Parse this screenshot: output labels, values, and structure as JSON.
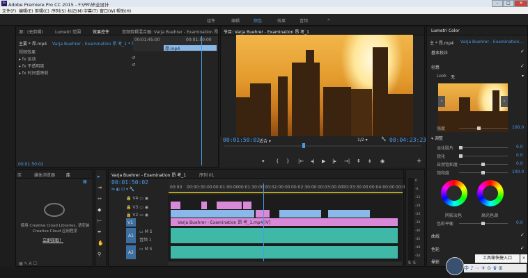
{
  "window": {
    "title": "Adobe Premiere Pro CC 2015 - F:\\PR\\毕业设计",
    "logo": "Pr"
  },
  "menu": [
    "文件(F)",
    "编辑(E)",
    "剪辑(C)",
    "序列(S)",
    "标记(M)",
    "字幕(T)",
    "窗口(W)",
    "帮助(H)"
  ],
  "workspaces": [
    "组件",
    "编辑",
    "颜色",
    "效果",
    "音频"
  ],
  "workspace_active": "颜色",
  "workspace_more": "»",
  "effect_controls": {
    "tabs": [
      "源：(无剪辑)",
      "Lumetri 范围",
      "效果控件",
      "音频剪辑混合器: Varja Buehrer - Examination 昂"
    ],
    "source": "主要 * 昂.mp4",
    "sequence": "Varja Buehrer - Examination 昂 考_1 * 昂...",
    "section": "视频效果",
    "ruler": [
      "00:01:45:00",
      "00:01:50:00"
    ],
    "clip": "昂.mp4",
    "items": [
      "fx 运动",
      "fx 不透明度",
      "fx 时间重映射"
    ],
    "timecode": "00:01:50:02"
  },
  "program": {
    "tab": "节目: Varja Buehrer - Examination 昂 考_1",
    "timecode": "00:01:50:02",
    "fit": "适合",
    "zoom": "1/2",
    "duration": "00:04:23:23"
  },
  "project": {
    "tabs": [
      "库",
      "媒体浏览器",
      "库"
    ],
    "cc_text": "使用 Creative Cloud Libraries, 请安装 Creative Cloud 应用程序",
    "cc_button": "立即获取！"
  },
  "timeline": {
    "tab": "Varja Buehrer - Examination 昂 考_1",
    "tab2": "序列 01",
    "timecode": "00:01:50:02",
    "ruler": [
      "00:00",
      "00:00:30:00",
      "00:01:00:00",
      "00:01:30:00",
      "00:02:00:00",
      "00:02:30:00",
      "00:03:00:00",
      "00:03:30:00",
      "00:04:00:00",
      "00:0"
    ],
    "tracks": [
      "V4",
      "V3",
      "V2",
      "V1",
      "A1",
      "A2"
    ],
    "audio_label": "音频 1",
    "clip_label": "Varja Buehrer - Examination 昂 考_1.mp4 [V]",
    "solo_labels": [
      "M",
      "S"
    ]
  },
  "lumetri": {
    "tab": "Lumetri Color",
    "source": "主 * 昂.mp4",
    "target": "Varja Buehrer - Examination...",
    "sections": [
      "基本校正",
      "创意",
      "曲线",
      "色轮",
      "晕影"
    ],
    "look_label": "Look",
    "look_value": "无",
    "intensity": {
      "label": "强度",
      "value": "100.0"
    },
    "adjust": "调整",
    "sliders": [
      {
        "label": "淡化胶片",
        "value": "0.0"
      },
      {
        "label": "锐化",
        "value": "0.0"
      },
      {
        "label": "自然饱和度",
        "value": "0.0"
      },
      {
        "label": "饱和度",
        "value": "100.0"
      }
    ],
    "wheel_labels": [
      "阴影淡色",
      "高光色调"
    ],
    "balance": {
      "label": "色彩平衡",
      "value": "0.0"
    }
  },
  "meter_labels": [
    "0",
    "-6",
    "-12",
    "-18",
    "-24",
    "-30",
    "-36",
    "-42",
    "-48",
    "-54"
  ],
  "meter_solo": [
    "S",
    "S"
  ],
  "taskbar": {
    "popup": "工具箱快捷入口",
    "sys": "中 ♪ ⋯ ✈ ⊙ ♛ ⊞"
  },
  "colors": {
    "accent": "#4c9be8",
    "clip_pink": "#d88ad8",
    "clip_blue": "#8ab8e8",
    "audio_teal": "#3fb8a8"
  }
}
